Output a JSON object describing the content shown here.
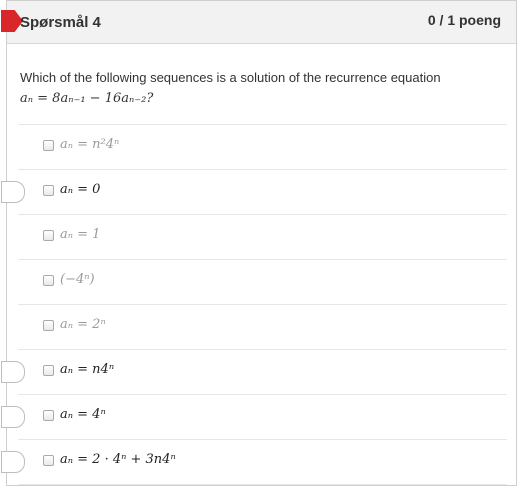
{
  "question": {
    "title": "Spørsmål 4",
    "score": "0 / 1 poeng",
    "prompt_text": "Which of the following sequences is a solution of the recurrence equation",
    "prompt_formula": "aₙ = 8aₙ₋₁ − 16aₙ₋₂?"
  },
  "options": [
    {
      "label": "aₙ = n²4ⁿ",
      "style": "dim",
      "marker": false
    },
    {
      "label": "aₙ = 0",
      "style": "normal",
      "marker": true
    },
    {
      "label": "aₙ = 1",
      "style": "dim",
      "marker": false
    },
    {
      "label": "(−4ⁿ)",
      "style": "dim",
      "marker": false
    },
    {
      "label": "aₙ = 2ⁿ",
      "style": "dim",
      "marker": false
    },
    {
      "label": "aₙ = n4ⁿ",
      "style": "normal",
      "marker": true
    },
    {
      "label": "aₙ = 4ⁿ",
      "style": "normal",
      "marker": true
    },
    {
      "label": "aₙ = 2 · 4ⁿ + 3n4ⁿ",
      "style": "normal",
      "marker": true
    }
  ]
}
